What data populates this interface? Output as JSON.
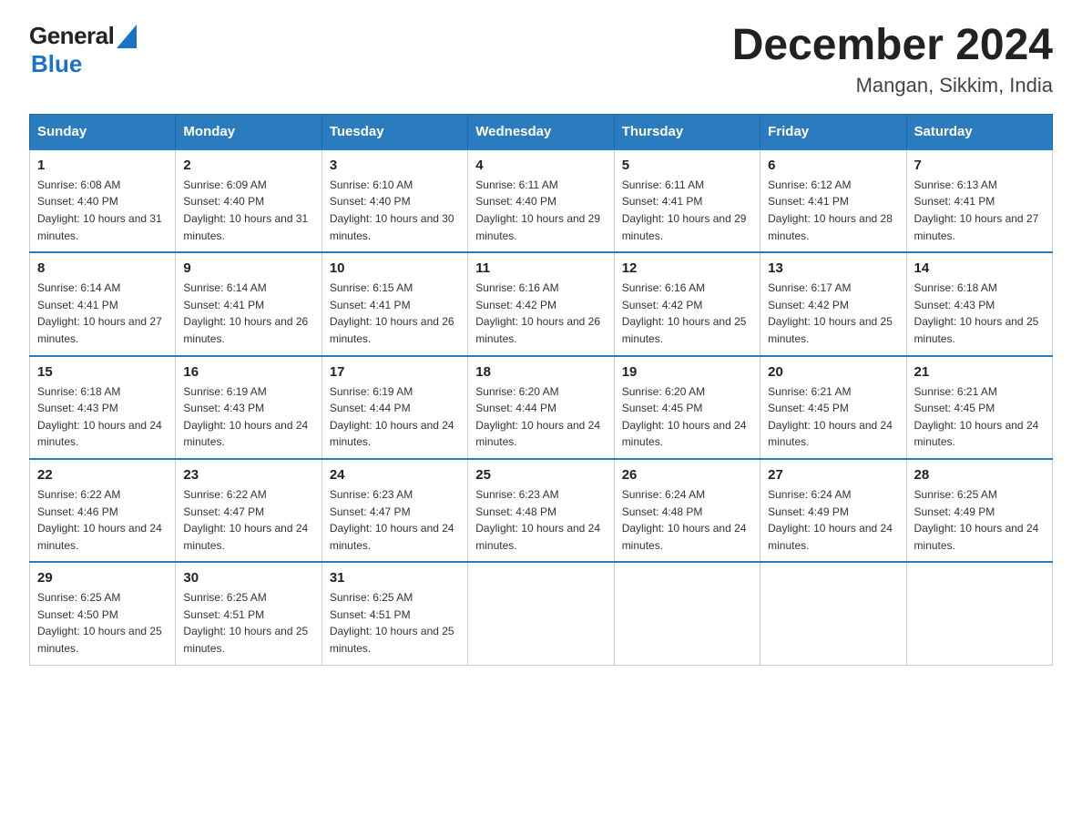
{
  "header": {
    "logo_general": "General",
    "logo_blue": "Blue",
    "month_title": "December 2024",
    "location": "Mangan, Sikkim, India"
  },
  "days_of_week": [
    "Sunday",
    "Monday",
    "Tuesday",
    "Wednesday",
    "Thursday",
    "Friday",
    "Saturday"
  ],
  "weeks": [
    [
      {
        "day": "1",
        "sunrise": "6:08 AM",
        "sunset": "4:40 PM",
        "daylight": "10 hours and 31 minutes."
      },
      {
        "day": "2",
        "sunrise": "6:09 AM",
        "sunset": "4:40 PM",
        "daylight": "10 hours and 31 minutes."
      },
      {
        "day": "3",
        "sunrise": "6:10 AM",
        "sunset": "4:40 PM",
        "daylight": "10 hours and 30 minutes."
      },
      {
        "day": "4",
        "sunrise": "6:11 AM",
        "sunset": "4:40 PM",
        "daylight": "10 hours and 29 minutes."
      },
      {
        "day": "5",
        "sunrise": "6:11 AM",
        "sunset": "4:41 PM",
        "daylight": "10 hours and 29 minutes."
      },
      {
        "day": "6",
        "sunrise": "6:12 AM",
        "sunset": "4:41 PM",
        "daylight": "10 hours and 28 minutes."
      },
      {
        "day": "7",
        "sunrise": "6:13 AM",
        "sunset": "4:41 PM",
        "daylight": "10 hours and 27 minutes."
      }
    ],
    [
      {
        "day": "8",
        "sunrise": "6:14 AM",
        "sunset": "4:41 PM",
        "daylight": "10 hours and 27 minutes."
      },
      {
        "day": "9",
        "sunrise": "6:14 AM",
        "sunset": "4:41 PM",
        "daylight": "10 hours and 26 minutes."
      },
      {
        "day": "10",
        "sunrise": "6:15 AM",
        "sunset": "4:41 PM",
        "daylight": "10 hours and 26 minutes."
      },
      {
        "day": "11",
        "sunrise": "6:16 AM",
        "sunset": "4:42 PM",
        "daylight": "10 hours and 26 minutes."
      },
      {
        "day": "12",
        "sunrise": "6:16 AM",
        "sunset": "4:42 PM",
        "daylight": "10 hours and 25 minutes."
      },
      {
        "day": "13",
        "sunrise": "6:17 AM",
        "sunset": "4:42 PM",
        "daylight": "10 hours and 25 minutes."
      },
      {
        "day": "14",
        "sunrise": "6:18 AM",
        "sunset": "4:43 PM",
        "daylight": "10 hours and 25 minutes."
      }
    ],
    [
      {
        "day": "15",
        "sunrise": "6:18 AM",
        "sunset": "4:43 PM",
        "daylight": "10 hours and 24 minutes."
      },
      {
        "day": "16",
        "sunrise": "6:19 AM",
        "sunset": "4:43 PM",
        "daylight": "10 hours and 24 minutes."
      },
      {
        "day": "17",
        "sunrise": "6:19 AM",
        "sunset": "4:44 PM",
        "daylight": "10 hours and 24 minutes."
      },
      {
        "day": "18",
        "sunrise": "6:20 AM",
        "sunset": "4:44 PM",
        "daylight": "10 hours and 24 minutes."
      },
      {
        "day": "19",
        "sunrise": "6:20 AM",
        "sunset": "4:45 PM",
        "daylight": "10 hours and 24 minutes."
      },
      {
        "day": "20",
        "sunrise": "6:21 AM",
        "sunset": "4:45 PM",
        "daylight": "10 hours and 24 minutes."
      },
      {
        "day": "21",
        "sunrise": "6:21 AM",
        "sunset": "4:45 PM",
        "daylight": "10 hours and 24 minutes."
      }
    ],
    [
      {
        "day": "22",
        "sunrise": "6:22 AM",
        "sunset": "4:46 PM",
        "daylight": "10 hours and 24 minutes."
      },
      {
        "day": "23",
        "sunrise": "6:22 AM",
        "sunset": "4:47 PM",
        "daylight": "10 hours and 24 minutes."
      },
      {
        "day": "24",
        "sunrise": "6:23 AM",
        "sunset": "4:47 PM",
        "daylight": "10 hours and 24 minutes."
      },
      {
        "day": "25",
        "sunrise": "6:23 AM",
        "sunset": "4:48 PM",
        "daylight": "10 hours and 24 minutes."
      },
      {
        "day": "26",
        "sunrise": "6:24 AM",
        "sunset": "4:48 PM",
        "daylight": "10 hours and 24 minutes."
      },
      {
        "day": "27",
        "sunrise": "6:24 AM",
        "sunset": "4:49 PM",
        "daylight": "10 hours and 24 minutes."
      },
      {
        "day": "28",
        "sunrise": "6:25 AM",
        "sunset": "4:49 PM",
        "daylight": "10 hours and 24 minutes."
      }
    ],
    [
      {
        "day": "29",
        "sunrise": "6:25 AM",
        "sunset": "4:50 PM",
        "daylight": "10 hours and 25 minutes."
      },
      {
        "day": "30",
        "sunrise": "6:25 AM",
        "sunset": "4:51 PM",
        "daylight": "10 hours and 25 minutes."
      },
      {
        "day": "31",
        "sunrise": "6:25 AM",
        "sunset": "4:51 PM",
        "daylight": "10 hours and 25 minutes."
      },
      null,
      null,
      null,
      null
    ]
  ],
  "labels": {
    "sunrise_prefix": "Sunrise: ",
    "sunset_prefix": "Sunset: ",
    "daylight_prefix": "Daylight: "
  }
}
